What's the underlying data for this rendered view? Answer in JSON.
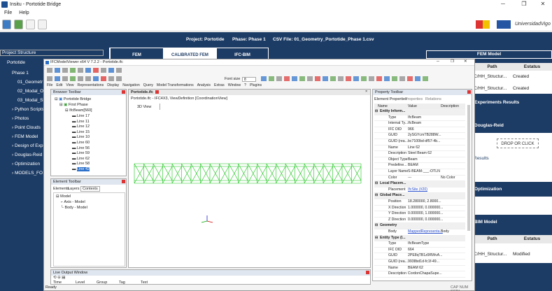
{
  "window": {
    "title": "Insitu - Portotide Bridge",
    "controls": [
      "─",
      "❐",
      "✕"
    ]
  },
  "menu": [
    "File",
    "Help"
  ],
  "header": {
    "project": "Project: Portotide",
    "phase": "Phase: Phase 1",
    "csv": "CSV File: 01_Geometry_Portotide_Phase 1.csv",
    "logo_text": "UniversidadVigo"
  },
  "left": {
    "title": "Project Structure",
    "items": [
      "Portotide",
      "Phase 1",
      "01_Geometr",
      "02_Modal_Ol",
      "03_Modal_Sh",
      "Python Scripts",
      "Photos",
      "Point Clouds",
      "FEM Model",
      "Design of Exp",
      "Douglas-Reid",
      "Optimization",
      "MODELS_FO"
    ]
  },
  "tabs": [
    "FEM",
    "CALIBRATED FEM",
    "IFC-BIM"
  ],
  "right": {
    "fem_title": "FEM Model",
    "table1": {
      "headers": [
        "Path",
        "Estatus"
      ],
      "rows": [
        [
          "C/HH_Structur...",
          "Created"
        ],
        [
          "C/HH_Structur...",
          "Created"
        ]
      ]
    },
    "experiments": "Experiments Results",
    "douglas": "Douglas-Reid",
    "drop": "DROP OR CLICK",
    "results": "Results",
    "optimization": "Optimization",
    "bim_title": "BIM Model",
    "table2": {
      "headers": [
        "Path",
        "Estatus"
      ],
      "rows": [
        [
          "C/HH_Structur...",
          "Modified"
        ]
      ]
    }
  },
  "ifc": {
    "title": "IFCModelViewer x64 V 7.2.2 - Portotide.ifc",
    "menu": [
      "File",
      "Edit",
      "View",
      "Representations",
      "Display",
      "Navigation",
      "Query",
      "Model Transformations",
      "Analysis",
      "Extras",
      "Window",
      "?",
      "Plugins"
    ],
    "font_size_label": "Font size",
    "font_size_value": "8",
    "browser": {
      "title": "Browser Toolbar",
      "root": "Portotide Bridge",
      "floor": "First Phase",
      "beam": "IfcBeam[560]",
      "lines": [
        "Line 17",
        "Line 11",
        "Line 12",
        "Line 15",
        "Line 10",
        "Line 60",
        "Line 56",
        "Line 59",
        "Line 62",
        "Line 58",
        "Line 42"
      ]
    },
    "element": {
      "title": "Element Toolbar",
      "tabs": [
        "Elements",
        "Layers",
        "Contexts"
      ],
      "items": [
        "Model",
        "Axis - Model",
        "Body - Model"
      ]
    },
    "viewport": {
      "tab": "Portotide.ifc",
      "desc": "Portotide.ifc - IFC4X3, ViewDefinition [CoordinationView]",
      "view": "3D View"
    },
    "output": {
      "title": "Live Output Window",
      "cols": [
        "Time",
        "Level",
        "Group",
        "Tag",
        "Text"
      ]
    },
    "status_left": "Ready",
    "status_right": "CAP NUM SCRL",
    "property": {
      "title": "Property Toolbar",
      "tabs": [
        "Element Properties",
        "Properties",
        "Relations"
      ],
      "headers": [
        "Name",
        "Value",
        "Description"
      ],
      "rows": [
        {
          "g": true,
          "k": "Entity Inform..."
        },
        {
          "k": "Type",
          "v": "IfcBeam"
        },
        {
          "k": "Internal Ty...",
          "v": "IfcBeam"
        },
        {
          "k": "IFC OID",
          "v": "966"
        },
        {
          "k": "GUID",
          "v": "2ySGYcmTB288W..."
        },
        {
          "k": "GUID (rea...",
          "v": "bc7100bd-df57-4b..."
        },
        {
          "k": "Name",
          "v": "Line 62"
        },
        {
          "k": "Description",
          "v": "Steel Beam 62"
        },
        {
          "k": "Object Type",
          "v": "Beam"
        },
        {
          "k": "Predefine...",
          "v": "BEAM"
        },
        {
          "k": "Layer Name",
          "v": "S-BEAM-___-OTLN"
        },
        {
          "k": "Color",
          "v": "---",
          "d": "No Color"
        },
        {
          "g": true,
          "k": "Local Placem..."
        },
        {
          "k": "Placement",
          "v": "IfcSite (#20)"
        },
        {
          "g": true,
          "k": "Global Place..."
        },
        {
          "k": "Position",
          "v": "18.280000, 2.8000..."
        },
        {
          "k": "X Direction",
          "v": "1.000000, 0.000000..."
        },
        {
          "k": "Y Direction",
          "v": "0.000000, 1.000000..."
        },
        {
          "k": "Z Direction",
          "v": "0.000000, 0.000000..."
        },
        {
          "g": true,
          "k": "Geometry"
        },
        {
          "k": "Body",
          "v": "MappedRepresenta...",
          "d": "Body"
        },
        {
          "g": true,
          "k": "Entity Type (I..."
        },
        {
          "k": "Type",
          "v": "IfcBeamType"
        },
        {
          "k": "IFC OID",
          "v": "664"
        },
        {
          "k": "GUID",
          "v": "2PE8qTB1z9RWvA..."
        },
        {
          "k": "GUID (rea...",
          "v": "9938bd1d-fc1f-49..."
        },
        {
          "k": "Name",
          "v": "BEAM 62"
        },
        {
          "k": "Description",
          "v": "CordonChapaSupe..."
        }
      ]
    }
  },
  "colors": {
    "navy": "#1d3c65",
    "bridge": "#18c418"
  }
}
